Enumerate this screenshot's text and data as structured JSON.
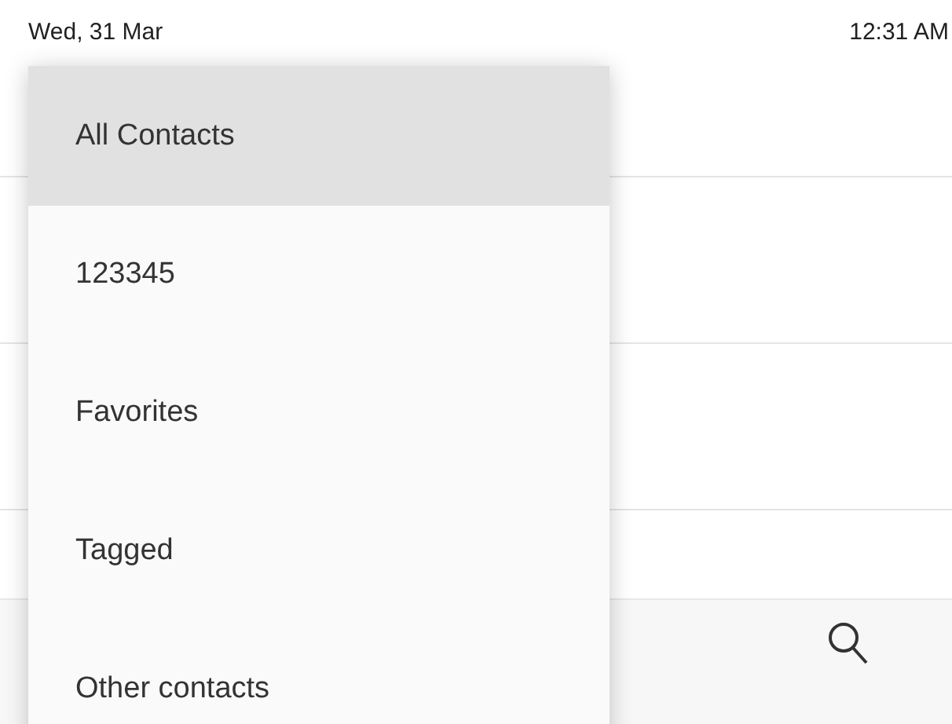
{
  "status_bar": {
    "date": "Wed, 31 Mar",
    "time": "12:31 AM"
  },
  "menu": {
    "items": [
      {
        "label": "All Contacts",
        "selected": true
      },
      {
        "label": "123345",
        "selected": false
      },
      {
        "label": "Favorites",
        "selected": false
      },
      {
        "label": "Tagged",
        "selected": false
      },
      {
        "label": "Other contacts",
        "selected": false
      }
    ]
  }
}
